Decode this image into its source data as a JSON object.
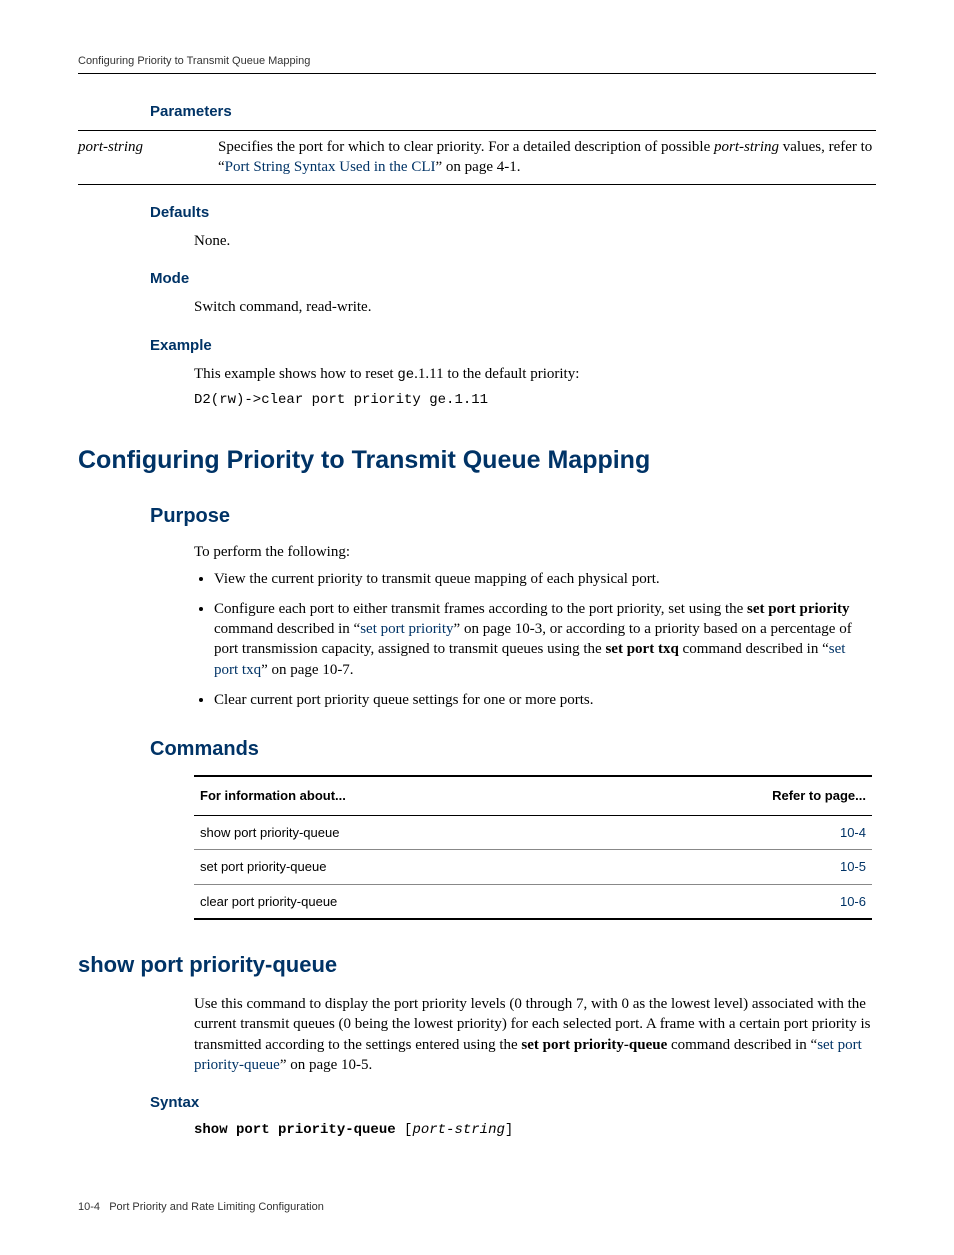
{
  "header": {
    "section": "Configuring Priority to Transmit Queue Mapping"
  },
  "params_section": {
    "heading": "Parameters",
    "rows": [
      {
        "name": "port-string",
        "desc_pre": "Specifies the port for which to clear priority. For a detailed description of possible ",
        "desc_italic": "port-string",
        "desc_mid": " values, refer to “",
        "desc_link": "Port String Syntax Used in the CLI",
        "desc_post": "” on page 4-1."
      }
    ]
  },
  "defaults_section": {
    "heading": "Defaults",
    "body": "None."
  },
  "mode_section": {
    "heading": "Mode",
    "body": "Switch command, read-write."
  },
  "example_section": {
    "heading": "Example",
    "intro_pre": "This example shows how to reset ",
    "intro_mono": "ge",
    "intro_post": ".1.11 to the default priority:",
    "code": "D2(rw)->clear port priority ge.1.11"
  },
  "main_heading": "Configuring Priority to Transmit Queue Mapping",
  "purpose_section": {
    "heading": "Purpose",
    "intro": "To perform the following:",
    "bullets": [
      {
        "plain": "View the current priority to transmit queue mapping of each physical port."
      },
      {
        "seg1": "Configure each port to either transmit frames according to the port priority, set using the ",
        "bold1": "set port priority",
        "seg2": " command described in “",
        "link1": "set port priority",
        "seg3": "” on page 10-3, or according to a priority based on a percentage of port transmission capacity, assigned to transmit queues using the ",
        "bold2": "set port txq",
        "seg4": " command described in “",
        "link2": "set port txq",
        "seg5": "” on page 10-7."
      },
      {
        "plain": "Clear current port priority queue settings for one or more ports."
      }
    ]
  },
  "commands_section": {
    "heading": "Commands",
    "col1": "For information about...",
    "col2": "Refer to page...",
    "rows": [
      {
        "name": "show port priority-queue",
        "page": "10-4"
      },
      {
        "name": "set port priority-queue",
        "page": "10-5"
      },
      {
        "name": "clear port priority-queue",
        "page": "10-6"
      }
    ]
  },
  "show_section": {
    "heading": "show port priority-queue",
    "p1a": "Use this command to display the port priority levels (0 through 7, with 0 as the lowest level) associated with the current transmit queues (0 being the lowest priority) for each selected port. A frame with a certain port priority is transmitted according to the settings entered using the ",
    "p1bold": "set port priority-queue",
    "p1b": " command described in “",
    "p1link": "set port priority-queue",
    "p1c": "” on page 10-5.",
    "syntax_heading": "Syntax",
    "syntax_bold": "show port priority-queue",
    "syntax_bracket_open": " [",
    "syntax_italic": "port-string",
    "syntax_bracket_close": "]"
  },
  "footer": {
    "page": "10-4",
    "title": "Port Priority and Rate Limiting Configuration"
  }
}
